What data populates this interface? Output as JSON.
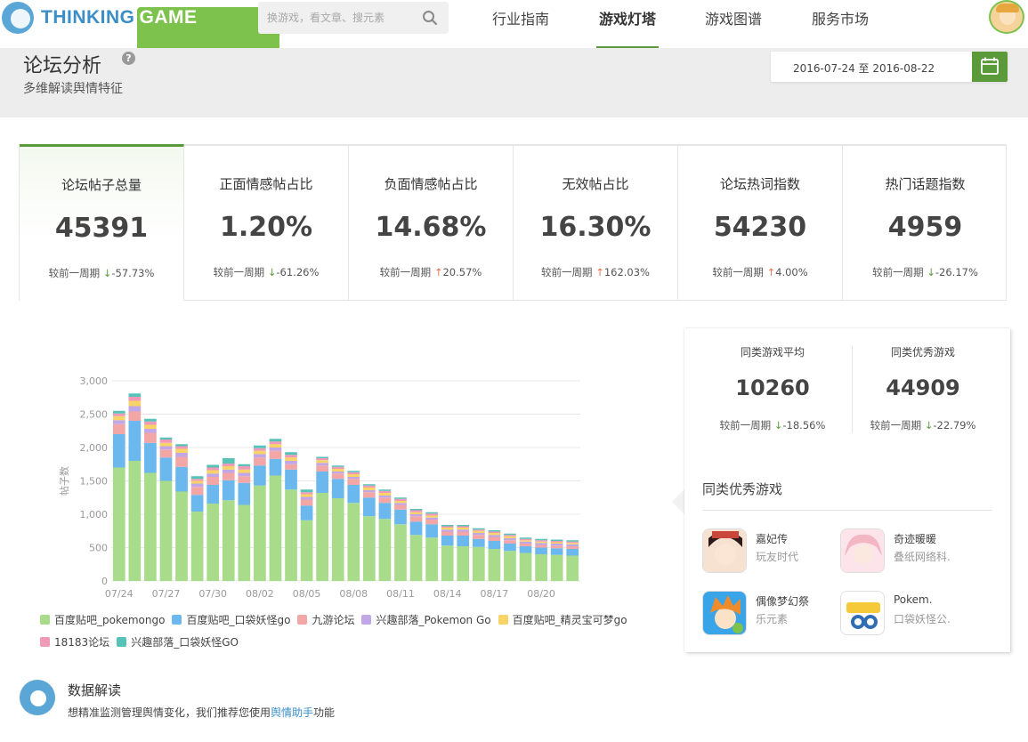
{
  "brand": {
    "name_part1": "THINKING",
    "name_part2": "GAME"
  },
  "search": {
    "placeholder": "换游戏，看文章、搜元素"
  },
  "nav": {
    "items": [
      "行业指南",
      "游戏灯塔",
      "游戏图谱",
      "服务市场"
    ],
    "active": "游戏灯塔"
  },
  "header": {
    "title": "论坛分析",
    "help": "?",
    "subtitle": "多维解读舆情特征",
    "date_range": "2016-07-24 至 2016-08-22"
  },
  "kpis": [
    {
      "title": "论坛帖子总量",
      "value": "45391",
      "prefix": "较前一周期",
      "arrow": "↓",
      "change": "-57.73%",
      "dir": "down"
    },
    {
      "title": "正面情感帖占比",
      "value": "1.20%",
      "prefix": "较前一周期",
      "arrow": "↓",
      "change": "-61.26%",
      "dir": "down"
    },
    {
      "title": "负面情感帖占比",
      "value": "14.68%",
      "prefix": "较前一周期",
      "arrow": "↑",
      "change": "20.57%",
      "dir": "up"
    },
    {
      "title": "无效帖占比",
      "value": "16.30%",
      "prefix": "较前一周期",
      "arrow": "↑",
      "change": "162.03%",
      "dir": "up"
    },
    {
      "title": "论坛热词指数",
      "value": "54230",
      "prefix": "较前一周期",
      "arrow": "↑",
      "change": "4.00%",
      "dir": "up"
    },
    {
      "title": "热门话题指数",
      "value": "4959",
      "prefix": "较前一周期",
      "arrow": "↓",
      "change": "-26.17%",
      "dir": "down"
    }
  ],
  "side": {
    "stat1": {
      "title": "同类游戏平均",
      "value": "10260",
      "prefix": "较前一周期",
      "arrow": "↓",
      "change": "-18.56%"
    },
    "stat2": {
      "title": "同类优秀游戏",
      "value": "44909",
      "prefix": "较前一周期",
      "arrow": "↓",
      "change": "-22.79%"
    },
    "section_title": "同类优秀游戏",
    "games": [
      {
        "name": "嘉妃传",
        "publisher": "玩友时代",
        "icon_color": "#c9473a"
      },
      {
        "name": "奇迹暖暖",
        "publisher": "叠纸网络科.",
        "icon_color": "#f3b6c3"
      },
      {
        "name": "偶像梦幻祭",
        "publisher": "乐元素",
        "icon_color": "#f08b2b"
      },
      {
        "name": "Pokem.",
        "publisher": "口袋妖怪公.",
        "icon_color": "#2f6db5"
      }
    ]
  },
  "interpretation": {
    "title": "数据解读",
    "text_before": "想精准监测管理舆情变化，我们推荐您使用",
    "link": "舆情助手",
    "text_after": "功能"
  },
  "chart_data": {
    "type": "bar",
    "stacked": true,
    "ylabel": "帖子数",
    "ylim": [
      0,
      3000
    ],
    "yticks": [
      "0",
      "500",
      "1,000",
      "1,500",
      "2,000",
      "2,500",
      "3,000"
    ],
    "x_tick_labels": [
      "07/24",
      "07/27",
      "07/30",
      "08/02",
      "08/05",
      "08/08",
      "08/11",
      "08/14",
      "08/17",
      "08/20"
    ],
    "categories": [
      "07/24",
      "07/25",
      "07/26",
      "07/27",
      "07/28",
      "07/29",
      "07/30",
      "07/31",
      "08/01",
      "08/02",
      "08/03",
      "08/04",
      "08/05",
      "08/06",
      "08/07",
      "08/08",
      "08/09",
      "08/10",
      "08/11",
      "08/12",
      "08/13",
      "08/14",
      "08/15",
      "08/16",
      "08/17",
      "08/18",
      "08/19",
      "08/20",
      "08/21",
      "08/22"
    ],
    "series": [
      {
        "name": "百度贴吧_pokemongo",
        "color": "#a9dc8a",
        "values": [
          1700,
          1800,
          1620,
          1500,
          1340,
          1040,
          1160,
          1210,
          1140,
          1430,
          1580,
          1370,
          910,
          1320,
          1240,
          1170,
          970,
          930,
          850,
          690,
          650,
          530,
          520,
          510,
          480,
          450,
          420,
          400,
          390,
          380
        ]
      },
      {
        "name": "百度贴吧_口袋妖怪go",
        "color": "#6ab8ee",
        "values": [
          500,
          600,
          450,
          350,
          370,
          250,
          280,
          300,
          330,
          300,
          250,
          300,
          220,
          320,
          290,
          270,
          280,
          240,
          220,
          200,
          200,
          150,
          160,
          120,
          120,
          110,
          100,
          100,
          100,
          100
        ]
      },
      {
        "name": "九游论坛",
        "color": "#f3a6a6",
        "values": [
          150,
          140,
          150,
          120,
          150,
          120,
          120,
          110,
          100,
          120,
          120,
          80,
          90,
          90,
          80,
          90,
          80,
          80,
          70,
          80,
          70,
          60,
          60,
          60,
          60,
          50,
          40,
          40,
          40,
          40
        ]
      },
      {
        "name": "兴趣部落_Pokemon Go",
        "color": "#c1a7e8",
        "values": [
          60,
          80,
          60,
          50,
          60,
          50,
          50,
          50,
          50,
          50,
          50,
          50,
          40,
          40,
          30,
          30,
          30,
          30,
          30,
          30,
          30,
          30,
          30,
          30,
          30,
          30,
          30,
          30,
          30,
          30
        ]
      },
      {
        "name": "百度贴吧_精灵宝可梦go",
        "color": "#f8d466",
        "values": [
          60,
          80,
          60,
          50,
          60,
          40,
          50,
          50,
          50,
          50,
          50,
          50,
          40,
          40,
          40,
          40,
          40,
          40,
          30,
          30,
          30,
          30,
          30,
          30,
          30,
          30,
          20,
          20,
          20,
          20
        ]
      },
      {
        "name": "18183论坛",
        "color": "#f09ab8",
        "values": [
          40,
          60,
          50,
          50,
          40,
          30,
          40,
          40,
          50,
          40,
          40,
          40,
          30,
          30,
          30,
          30,
          30,
          30,
          30,
          30,
          30,
          20,
          20,
          20,
          20,
          20,
          20,
          20,
          20,
          20
        ]
      },
      {
        "name": "兴趣部落_口袋妖怪GO",
        "color": "#56c2b8",
        "values": [
          40,
          50,
          40,
          30,
          30,
          40,
          40,
          80,
          30,
          40,
          40,
          40,
          40,
          20,
          20,
          20,
          20,
          20,
          20,
          20,
          20,
          20,
          20,
          20,
          20,
          20,
          20,
          20,
          20,
          20
        ]
      }
    ]
  }
}
